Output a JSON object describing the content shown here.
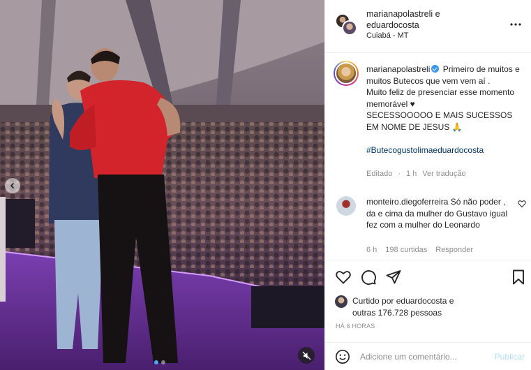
{
  "header": {
    "user_line": "marianapolastreli e eduardocosta",
    "location": "Cuiabá - MT"
  },
  "caption": {
    "username": "marianapolastreli",
    "text_lines": [
      "Primeiro de muitos e muitos Butecos que vem vem aí .",
      "Muito feliz de presenciar esse momento memorável ♥",
      "SECESSOOOOO E MAIS SUCESSOS EM NOME DE JESUS 🙏"
    ],
    "hashtag": "#Butecogustolimaeduardocosta",
    "edited_label": "Editado",
    "age": "1 h",
    "translate_label": "Ver tradução"
  },
  "comment": {
    "username": "monteiro.diegoferreira",
    "text": "Só não poder , da e cima da mulher do Gustavo igual fez com a mulher do Leonardo",
    "age": "6 h",
    "likes": "198 curtidas",
    "reply_label": "Responder"
  },
  "likes": {
    "prefix": "Curtido por",
    "user": "eduardocosta",
    "conj": "e",
    "others": "outras 176.728 pessoas"
  },
  "timestamp": "HÁ 6 HORAS",
  "add_comment": {
    "placeholder": "Adicione um comentário...",
    "post_label": "Publicar"
  },
  "icons": [
    "chevron-left-icon",
    "mute-icon",
    "more-icon",
    "heart-icon",
    "comment-icon",
    "share-icon",
    "bookmark-icon",
    "emoji-icon"
  ],
  "colors": {
    "verified": "#3897f0",
    "hashtag": "#00376b",
    "muted_text": "#8e8e8e",
    "post_button": "#b2dffc",
    "carousel_active_dot": "#4aa8ff"
  }
}
